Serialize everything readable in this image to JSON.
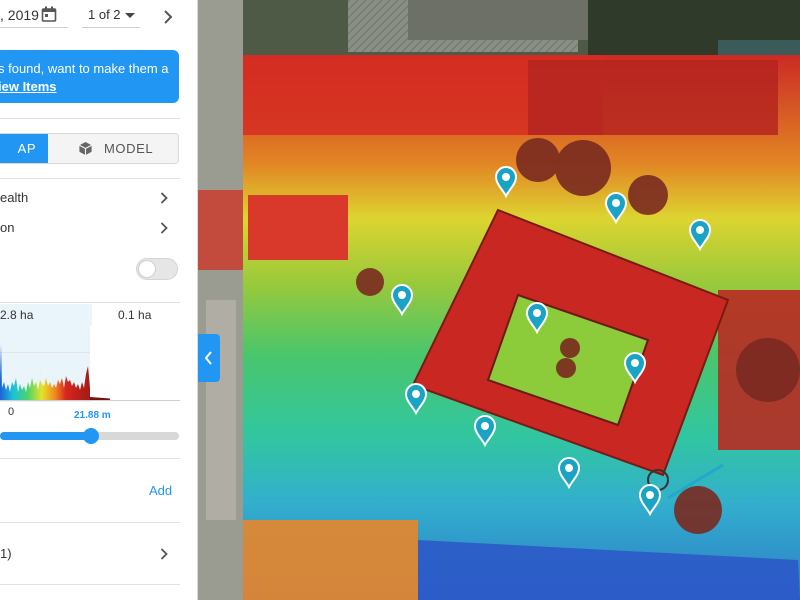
{
  "toolbar": {
    "date_text": ", 2019",
    "page_select": "1 of 2"
  },
  "banner": {
    "line1": "s found, want to make them a",
    "link": "iew Items"
  },
  "view_toggle": {
    "map_label": "AP",
    "model_label": "MODEL",
    "active": "map"
  },
  "layers": {
    "items": [
      {
        "label": "ealth"
      },
      {
        "label": "on"
      }
    ],
    "switch_on": false
  },
  "elevation": {
    "area_left": "2.8 ha",
    "area_right": "0.1 ha",
    "axis_zero": "0",
    "threshold_label": "21.88 m",
    "slider_fraction": 0.5
  },
  "annotations": {
    "add_label": "Add"
  },
  "list": {
    "item_label": "1)"
  },
  "colors": {
    "accent": "#2196f3",
    "pin": "#1aa3c4"
  }
}
